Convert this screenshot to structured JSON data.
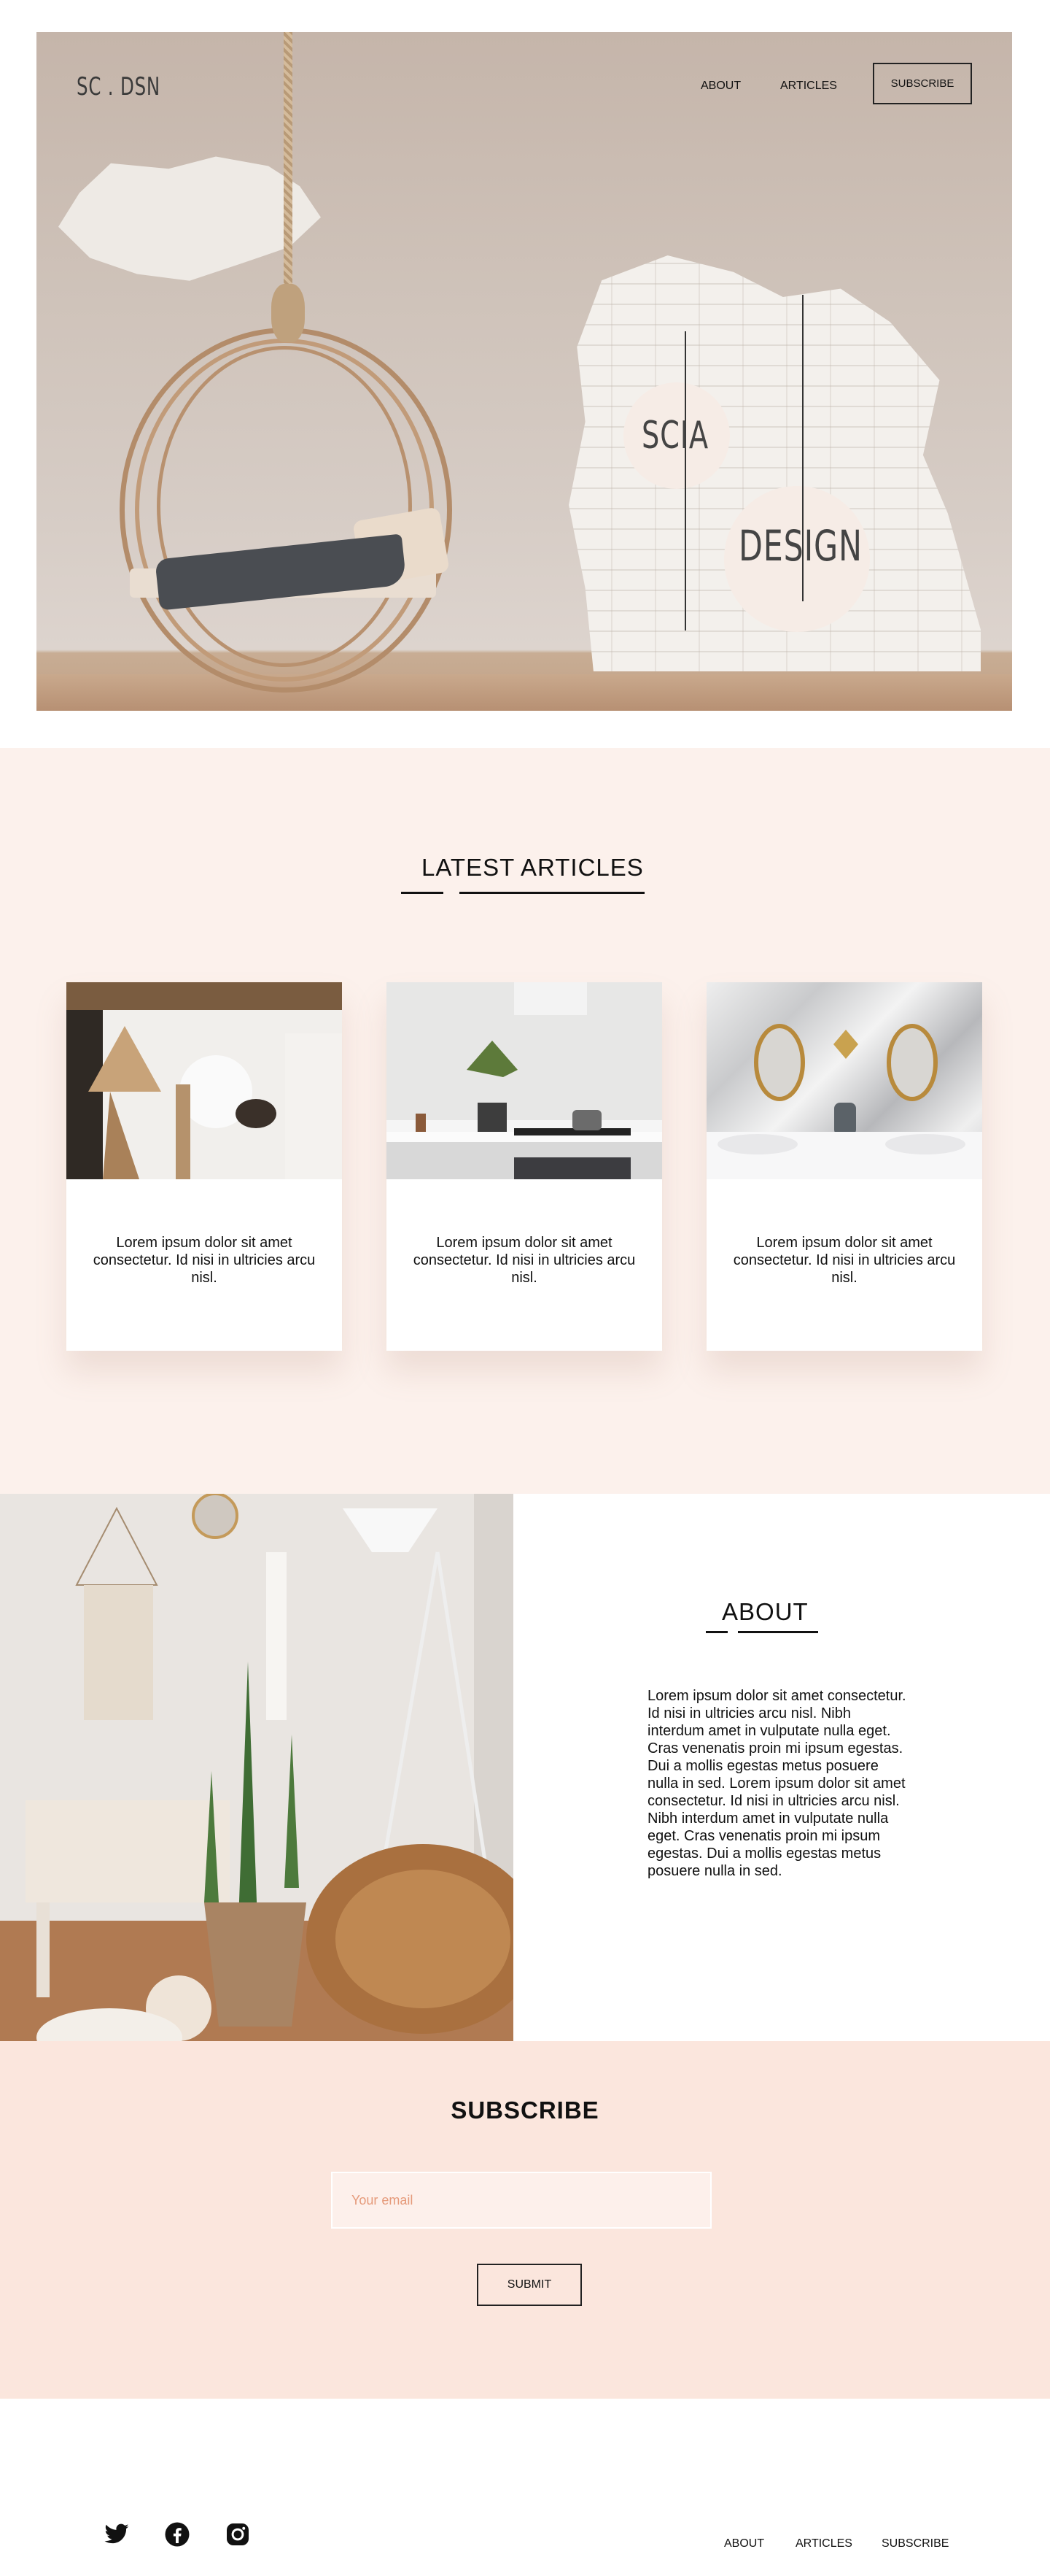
{
  "header": {
    "logo": "SC . DSN",
    "nav": {
      "about": "ABOUT",
      "articles": "ARTICLES",
      "subscribe": "SUBSCRIBE"
    }
  },
  "hero": {
    "word_top": "SCIA",
    "word_bottom": "DESIGN"
  },
  "articles": {
    "title": "LATEST ARTICLES",
    "cards": [
      {
        "text": "Lorem ipsum dolor sit amet consectetur. Id nisi in ultricies arcu nisl."
      },
      {
        "text": "Lorem ipsum dolor sit amet consectetur. Id nisi in ultricies arcu nisl."
      },
      {
        "text": "Lorem ipsum dolor sit amet consectetur. Id nisi in ultricies arcu nisl."
      }
    ]
  },
  "about": {
    "title": "ABOUT",
    "body": "Lorem ipsum dolor sit amet consectetur. Id nisi in ultricies arcu nisl. Nibh interdum amet in vulputate nulla eget. Cras venenatis proin mi ipsum egestas. Dui a mollis egestas metus posuere nulla in sed. Lorem ipsum dolor sit amet consectetur. Id nisi in ultricies arcu nisl. Nibh interdum amet in vulputate nulla eget. Cras venenatis proin mi ipsum egestas. Dui a mollis egestas metus posuere nulla in sed."
  },
  "subscribe": {
    "title": "SUBSCRIBE",
    "email_placeholder": "Your email",
    "submit_label": "SUBMIT"
  },
  "footer": {
    "social_icons": [
      "twitter-icon",
      "facebook-icon",
      "instagram-icon"
    ],
    "links": {
      "about": "ABOUT",
      "articles": "ARTICLES",
      "subscribe": "SUBSCRIBE"
    }
  },
  "colors": {
    "articles_bg": "#fcf1ec",
    "subscribe_bg": "#fbe6dd",
    "placeholder": "#e59a7a"
  }
}
